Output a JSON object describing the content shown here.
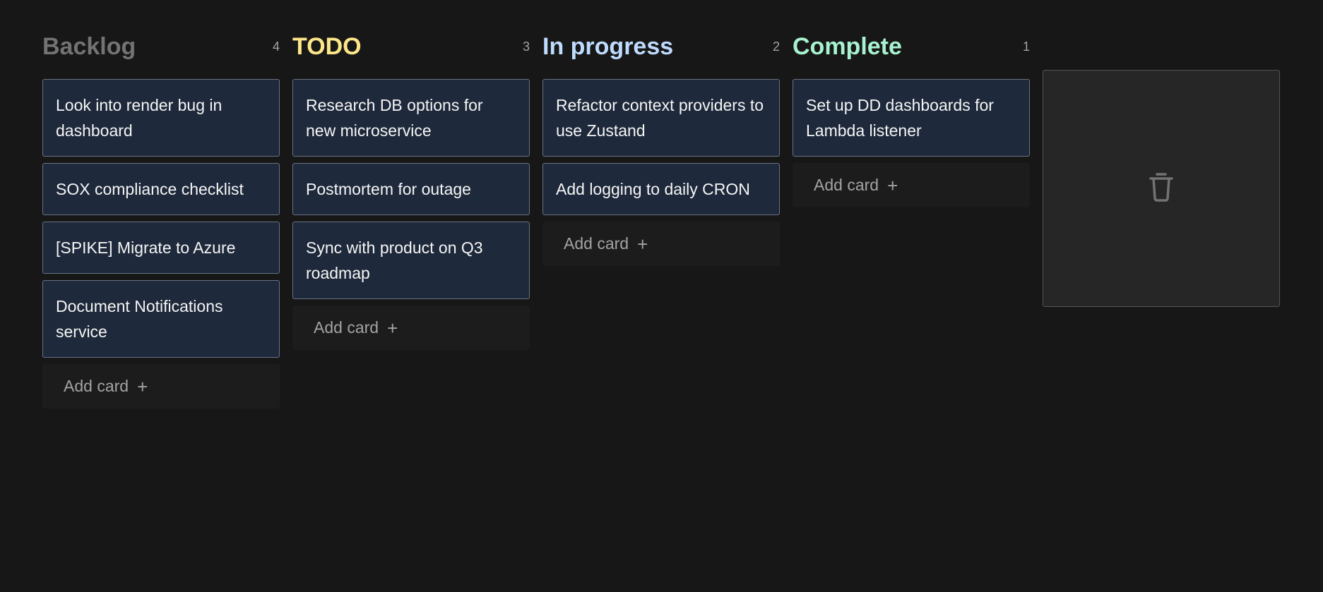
{
  "columns": [
    {
      "title": "Backlog",
      "count": "4",
      "color": "#737373",
      "cards": [
        "Look into render bug in dashboard",
        "SOX compliance checklist",
        "[SPIKE] Migrate to Azure",
        "Document Notifications service"
      ],
      "add_label": "Add card"
    },
    {
      "title": "TODO",
      "count": "3",
      "color": "#fde68a",
      "cards": [
        "Research DB options for new microservice",
        "Postmortem for outage",
        "Sync with product on Q3 roadmap"
      ],
      "add_label": "Add card"
    },
    {
      "title": "In progress",
      "count": "2",
      "color": "#bfdbfe",
      "cards": [
        "Refactor context providers to use Zustand",
        "Add logging to daily CRON"
      ],
      "add_label": "Add card"
    },
    {
      "title": "Complete",
      "count": "1",
      "color": "#a7f3d0",
      "cards": [
        "Set up DD dashboards for Lambda listener"
      ],
      "add_label": "Add card"
    }
  ],
  "add_icon": "plus-icon",
  "trash": {
    "icon": "trash-icon"
  },
  "colors": {
    "background": "#171717",
    "card_bg": "#1e293b",
    "card_border": "#6b7280",
    "trash_bg": "#262626"
  }
}
